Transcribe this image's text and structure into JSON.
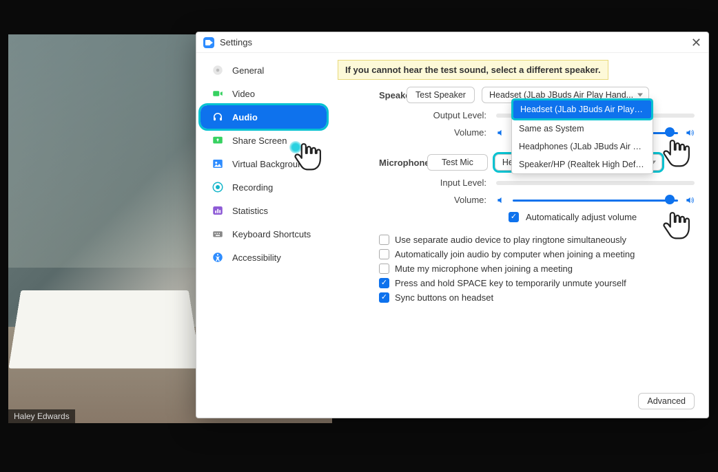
{
  "participant_name": "Haley Edwards",
  "window": {
    "title": "Settings"
  },
  "sidebar": {
    "items": [
      {
        "label": "General"
      },
      {
        "label": "Video"
      },
      {
        "label": "Audio"
      },
      {
        "label": "Share Screen"
      },
      {
        "label": "Virtual Background"
      },
      {
        "label": "Recording"
      },
      {
        "label": "Statistics"
      },
      {
        "label": "Keyboard Shortcuts"
      },
      {
        "label": "Accessibility"
      }
    ]
  },
  "hint": "If you cannot hear the test sound, select a different speaker.",
  "speaker": {
    "heading": "Speaker",
    "test_label": "Test Speaker",
    "selected": "Headset (JLab JBuds Air Play Hand...",
    "output_label": "Output Level:",
    "volume_label": "Volume:"
  },
  "speaker_dropdown": {
    "opt0": "Headset (JLab JBuds Air Play Hands-Fre...",
    "opt1": "Same as System",
    "opt2": "Headphones (JLab JBuds Air Play Stereo)",
    "opt3": "Speaker/HP (Realtek High Definition Au..."
  },
  "microphone": {
    "heading": "Microphone",
    "test_label": "Test Mic",
    "selected": "Headset (JLab JBuds Air Play Hand...",
    "input_label": "Input Level:",
    "volume_label": "Volume:",
    "auto_adjust": "Automatically adjust volume"
  },
  "options": {
    "separate": "Use separate audio device to play ringtone simultaneously",
    "autojoin": "Automatically join audio by computer when joining a meeting",
    "mutemic": "Mute my microphone when joining a meeting",
    "spacekey": "Press and hold SPACE key to temporarily unmute yourself",
    "syncbtn": "Sync buttons on headset"
  },
  "advanced_label": "Advanced"
}
